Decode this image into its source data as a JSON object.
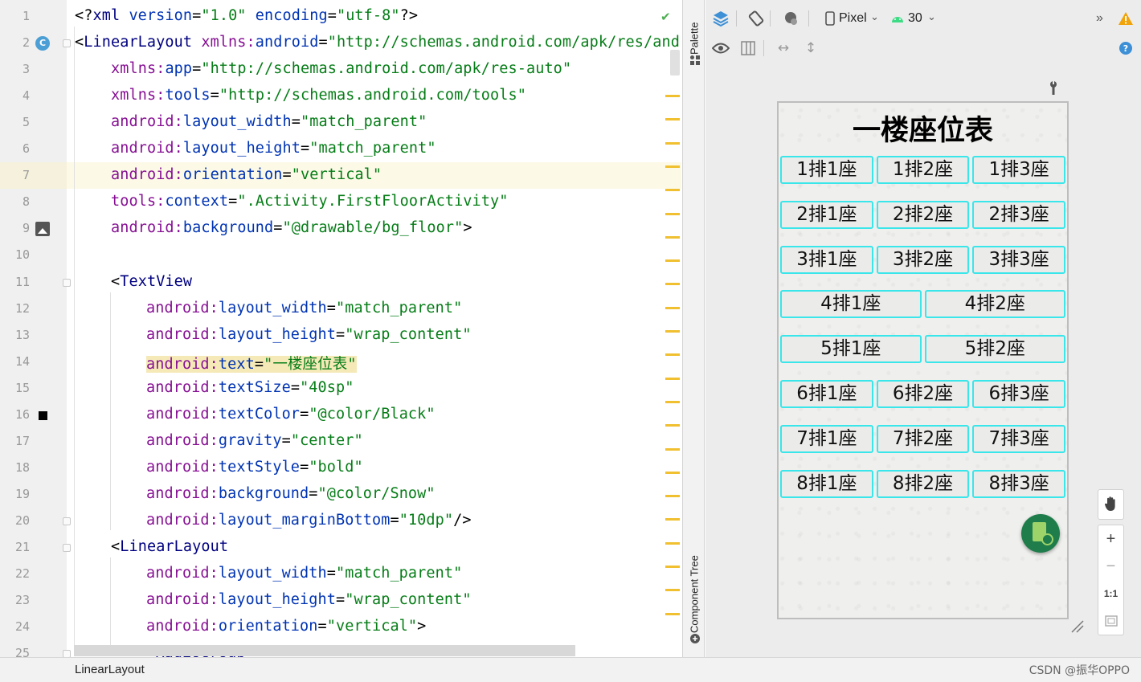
{
  "editor": {
    "current_line": 7,
    "lines": [
      {
        "n": "1",
        "indent": 0,
        "tokens": [
          [
            "p",
            "<?"
          ],
          [
            "tag",
            "xml "
          ],
          [
            "attr",
            "version"
          ],
          [
            "p",
            "="
          ],
          [
            "str",
            "\"1.0\" "
          ],
          [
            "attr",
            "encoding"
          ],
          [
            "p",
            "="
          ],
          [
            "str",
            "\"utf-8\""
          ],
          [
            "p",
            "?>"
          ]
        ]
      },
      {
        "n": "2",
        "indent": 0,
        "icon": "class-icon",
        "icon_label": "C",
        "fold": true,
        "tokens": [
          [
            "p",
            "<"
          ],
          [
            "tag",
            "LinearLayout "
          ],
          [
            "ns",
            "xmlns:"
          ],
          [
            "attr",
            "android"
          ],
          [
            "p",
            "="
          ],
          [
            "str",
            "\"http://schemas.android.com/apk/res/andr"
          ]
        ]
      },
      {
        "n": "3",
        "indent": 1,
        "tokens": [
          [
            "ns",
            "xmlns:"
          ],
          [
            "attr",
            "app"
          ],
          [
            "p",
            "="
          ],
          [
            "str",
            "\"http://schemas.android.com/apk/res-auto\""
          ]
        ]
      },
      {
        "n": "4",
        "indent": 1,
        "tokens": [
          [
            "ns",
            "xmlns:"
          ],
          [
            "attr",
            "tools"
          ],
          [
            "p",
            "="
          ],
          [
            "str",
            "\"http://schemas.android.com/tools\""
          ]
        ]
      },
      {
        "n": "5",
        "indent": 1,
        "tokens": [
          [
            "ns",
            "android:"
          ],
          [
            "attr",
            "layout_width"
          ],
          [
            "p",
            "="
          ],
          [
            "str",
            "\"match_parent\""
          ]
        ]
      },
      {
        "n": "6",
        "indent": 1,
        "tokens": [
          [
            "ns",
            "android:"
          ],
          [
            "attr",
            "layout_height"
          ],
          [
            "p",
            "="
          ],
          [
            "str",
            "\"match_parent\""
          ]
        ]
      },
      {
        "n": "7",
        "indent": 1,
        "tokens": [
          [
            "ns",
            "android:"
          ],
          [
            "attr",
            "orientation"
          ],
          [
            "p",
            "="
          ],
          [
            "str",
            "\"vertical\""
          ]
        ]
      },
      {
        "n": "8",
        "indent": 1,
        "tokens": [
          [
            "ns",
            "tools:"
          ],
          [
            "attr",
            "context"
          ],
          [
            "p",
            "="
          ],
          [
            "str",
            "\".Activity.FirstFloorActivity\""
          ]
        ]
      },
      {
        "n": "9",
        "indent": 1,
        "icon": "image-icon",
        "tokens": [
          [
            "ns",
            "android:"
          ],
          [
            "attr",
            "background"
          ],
          [
            "p",
            "="
          ],
          [
            "str",
            "\"@drawable/bg_floor\""
          ],
          [
            "p",
            ">"
          ]
        ]
      },
      {
        "n": "10",
        "indent": 0,
        "tokens": []
      },
      {
        "n": "11",
        "indent": 1,
        "fold": true,
        "tokens": [
          [
            "p",
            "<"
          ],
          [
            "tag",
            "TextView"
          ]
        ]
      },
      {
        "n": "12",
        "indent": 2,
        "tokens": [
          [
            "ns",
            "android:"
          ],
          [
            "attr",
            "layout_width"
          ],
          [
            "p",
            "="
          ],
          [
            "str",
            "\"match_parent\""
          ]
        ]
      },
      {
        "n": "13",
        "indent": 2,
        "tokens": [
          [
            "ns",
            "android:"
          ],
          [
            "attr",
            "layout_height"
          ],
          [
            "p",
            "="
          ],
          [
            "str",
            "\"wrap_content\""
          ]
        ]
      },
      {
        "n": "14",
        "indent": 2,
        "highlight": true,
        "tokens": [
          [
            "ns",
            "android:"
          ],
          [
            "attr",
            "text"
          ],
          [
            "p",
            "="
          ],
          [
            "str",
            "\"一楼座位表\""
          ]
        ]
      },
      {
        "n": "15",
        "indent": 2,
        "tokens": [
          [
            "ns",
            "android:"
          ],
          [
            "attr",
            "textSize"
          ],
          [
            "p",
            "="
          ],
          [
            "str",
            "\"40sp\""
          ]
        ]
      },
      {
        "n": "16",
        "indent": 2,
        "icon": "color-icon",
        "tokens": [
          [
            "ns",
            "android:"
          ],
          [
            "attr",
            "textColor"
          ],
          [
            "p",
            "="
          ],
          [
            "str",
            "\"@color/Black\""
          ]
        ]
      },
      {
        "n": "17",
        "indent": 2,
        "tokens": [
          [
            "ns",
            "android:"
          ],
          [
            "attr",
            "gravity"
          ],
          [
            "p",
            "="
          ],
          [
            "str",
            "\"center\""
          ]
        ]
      },
      {
        "n": "18",
        "indent": 2,
        "tokens": [
          [
            "ns",
            "android:"
          ],
          [
            "attr",
            "textStyle"
          ],
          [
            "p",
            "="
          ],
          [
            "str",
            "\"bold\""
          ]
        ]
      },
      {
        "n": "19",
        "indent": 2,
        "tokens": [
          [
            "ns",
            "android:"
          ],
          [
            "attr",
            "background"
          ],
          [
            "p",
            "="
          ],
          [
            "str",
            "\"@color/Snow\""
          ]
        ]
      },
      {
        "n": "20",
        "indent": 2,
        "fold": true,
        "tokens": [
          [
            "ns",
            "android:"
          ],
          [
            "attr",
            "layout_marginBottom"
          ],
          [
            "p",
            "="
          ],
          [
            "str",
            "\"10dp\""
          ],
          [
            "p",
            "/>"
          ]
        ]
      },
      {
        "n": "21",
        "indent": 1,
        "fold": true,
        "tokens": [
          [
            "p",
            "<"
          ],
          [
            "tag",
            "LinearLayout"
          ]
        ]
      },
      {
        "n": "22",
        "indent": 2,
        "tokens": [
          [
            "ns",
            "android:"
          ],
          [
            "attr",
            "layout_width"
          ],
          [
            "p",
            "="
          ],
          [
            "str",
            "\"match_parent\""
          ]
        ]
      },
      {
        "n": "23",
        "indent": 2,
        "tokens": [
          [
            "ns",
            "android:"
          ],
          [
            "attr",
            "layout_height"
          ],
          [
            "p",
            "="
          ],
          [
            "str",
            "\"wrap_content\""
          ]
        ]
      },
      {
        "n": "24",
        "indent": 2,
        "tokens": [
          [
            "ns",
            "android:"
          ],
          [
            "attr",
            "orientation"
          ],
          [
            "p",
            "="
          ],
          [
            "str",
            "\"vertical\""
          ],
          [
            "p",
            ">"
          ]
        ]
      },
      {
        "n": "25",
        "indent": 2,
        "fold": true,
        "tokens": [
          [
            "p",
            "<"
          ],
          [
            "tag",
            "RadioGroup"
          ]
        ]
      }
    ]
  },
  "side_tabs": {
    "palette": "Palette",
    "component_tree": "Component Tree"
  },
  "design_toolbar": {
    "device": "Pixel",
    "api_level": "30",
    "overflow": "»"
  },
  "preview": {
    "title": "一楼座位表",
    "rows": [
      [
        "1排1座",
        "1排2座",
        "1排3座"
      ],
      [
        "2排1座",
        "2排2座",
        "2排3座"
      ],
      [
        "3排1座",
        "3排2座",
        "3排3座"
      ],
      [
        "4排1座",
        "4排2座"
      ],
      [
        "5排1座",
        "5排2座"
      ],
      [
        "6排1座",
        "6排2座",
        "6排3座"
      ],
      [
        "7排1座",
        "7排2座",
        "7排3座"
      ],
      [
        "8排1座",
        "8排2座",
        "8排3座"
      ]
    ]
  },
  "zoom_controls": {
    "zoom_in": "+",
    "zoom_out": "−",
    "actual_size": "1:1"
  },
  "status_bar": {
    "breadcrumb": "LinearLayout",
    "watermark": "CSDN @振华OPPO"
  },
  "colors": {
    "seat_border": "#39e6ea",
    "warning_mark": "#f0c030",
    "fab": "#1e7d4a"
  }
}
